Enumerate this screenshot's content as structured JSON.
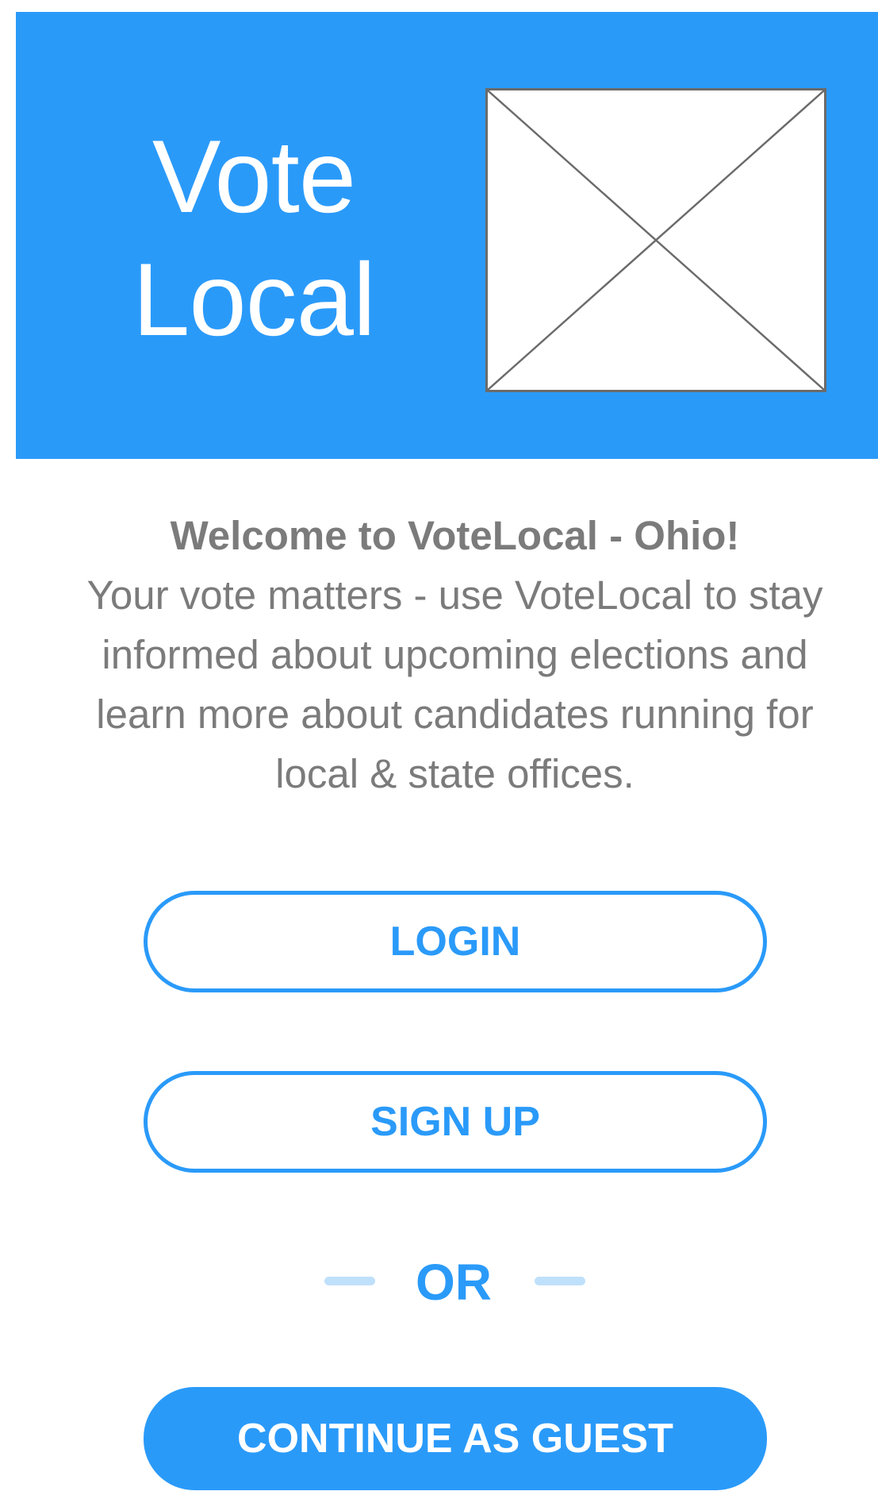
{
  "header": {
    "brand_line1": "Vote",
    "brand_line2": "Local",
    "image_placeholder": "image-placeholder-icon"
  },
  "welcome": {
    "title": "Welcome to VoteLocal - Ohio!",
    "body": "Your vote matters - use VoteLocal to stay informed about upcoming elections and learn more about candidates running for local & state offices."
  },
  "actions": {
    "login_label": "LOGIN",
    "signup_label": "SIGN UP",
    "or_label": "OR",
    "guest_label": "CONTINUE AS GUEST"
  },
  "colors": {
    "accent": "#2a9af9",
    "text_muted": "#7b7b7b",
    "divider": "#bfe0fb",
    "placeholder_stroke": "#6b6b6b"
  }
}
